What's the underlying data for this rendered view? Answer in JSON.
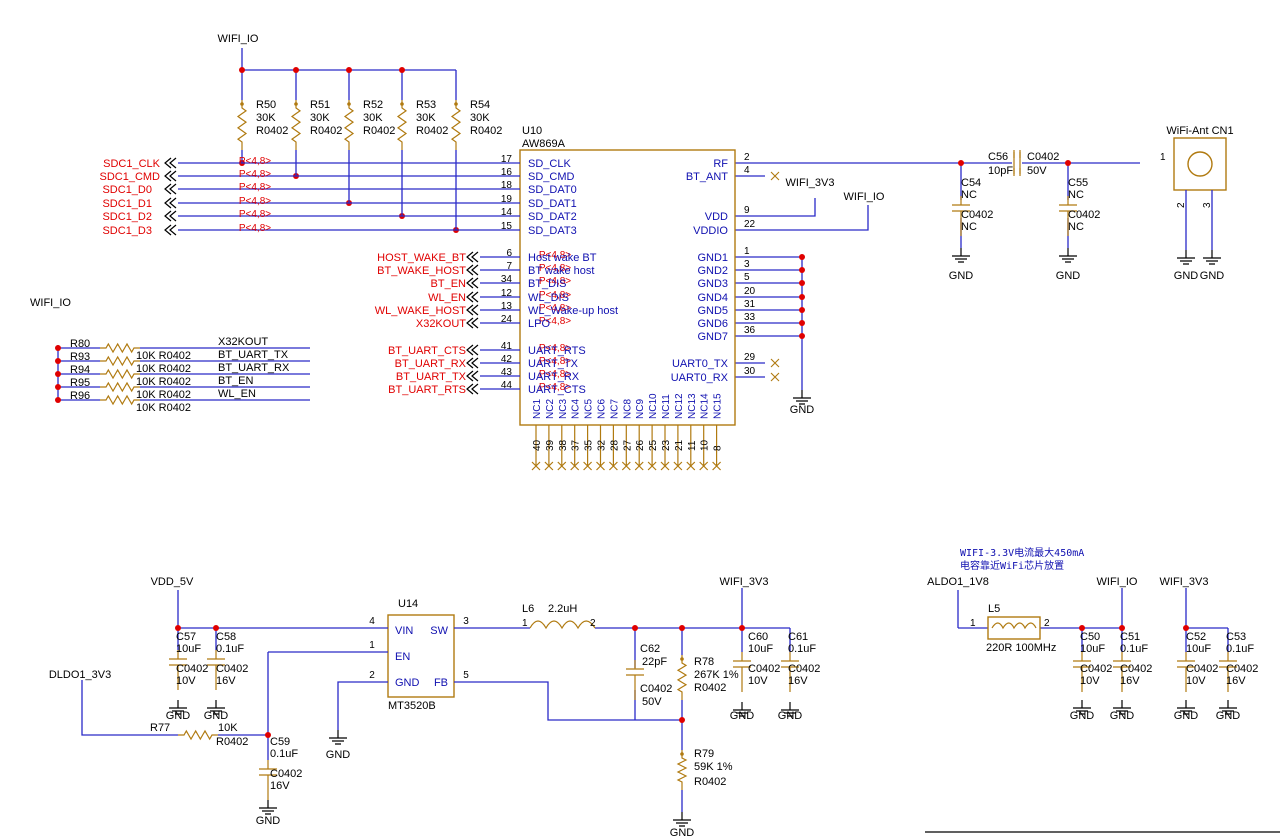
{
  "colors": {
    "wire": "#2a2ac8",
    "net_label": "#e00000",
    "pin_name": "#1010b0",
    "part_outline": "#b07a10",
    "junction": "#e00000"
  },
  "power": {
    "wifi_io": "WIFI_IO",
    "wifi_3v3": "WIFI_3V3",
    "vdd_5v": "VDD_5V",
    "dldo1": "DLDO1_3V3",
    "aldo1": "ALDO1_1V8",
    "gnd": "GND"
  },
  "pullups": [
    {
      "ref": "R50",
      "val": "30K",
      "pkg": "R0402"
    },
    {
      "ref": "R51",
      "val": "30K",
      "pkg": "R0402"
    },
    {
      "ref": "R52",
      "val": "30K",
      "pkg": "R0402"
    },
    {
      "ref": "R53",
      "val": "30K",
      "pkg": "R0402"
    },
    {
      "ref": "R54",
      "val": "30K",
      "pkg": "R0402"
    }
  ],
  "u10": {
    "ref": "U10",
    "part": "AW869A",
    "left_pins": [
      {
        "num": "17",
        "name": "SD_CLK",
        "net": "SDC1_CLK",
        "port": "P<4,8>"
      },
      {
        "num": "16",
        "name": "SD_CMD",
        "net": "SDC1_CMD",
        "port": "P<4,8>"
      },
      {
        "num": "18",
        "name": "SD_DAT0",
        "net": "SDC1_D0",
        "port": "P<4,8>"
      },
      {
        "num": "19",
        "name": "SD_DAT1",
        "net": "SDC1_D1",
        "port": "P<4,8>"
      },
      {
        "num": "14",
        "name": "SD_DAT2",
        "net": "SDC1_D2",
        "port": "P<4,8>"
      },
      {
        "num": "15",
        "name": "SD_DAT3",
        "net": "SDC1_D3",
        "port": "P<4,8>"
      },
      {
        "num": "6",
        "name": "Host wake BT",
        "net": "HOST_WAKE_BT",
        "port": "P<4,8>"
      },
      {
        "num": "7",
        "name": "BT wake host",
        "net": "BT_WAKE_HOST",
        "port": "P<4,8>"
      },
      {
        "num": "34",
        "name": "BT_DIS",
        "net": "BT_EN",
        "port": "P<4,8>"
      },
      {
        "num": "12",
        "name": "WL_DIS",
        "net": "WL_EN",
        "port": "P<4,8>"
      },
      {
        "num": "13",
        "name": "WL_Wake-up host",
        "net": "WL_WAKE_HOST",
        "port": "P<4,8>"
      },
      {
        "num": "24",
        "name": "LPO",
        "net": "X32KOUT",
        "port": "P<4,8>"
      },
      {
        "num": "41",
        "name": "UART_RTS",
        "net": "BT_UART_CTS",
        "port": "P<4,8>"
      },
      {
        "num": "42",
        "name": "UART_TX",
        "net": "BT_UART_RX",
        "port": "P<4,8>"
      },
      {
        "num": "43",
        "name": "UART_RX",
        "net": "BT_UART_TX",
        "port": "P<4,8>"
      },
      {
        "num": "44",
        "name": "UART_CTS",
        "net": "BT_UART_RTS",
        "port": "P<4,8>"
      }
    ],
    "right_pins": [
      {
        "num": "2",
        "name": "RF"
      },
      {
        "num": "4",
        "name": "BT_ANT"
      },
      {
        "num": "9",
        "name": "VDD"
      },
      {
        "num": "22",
        "name": "VDDIO"
      },
      {
        "num": "1",
        "name": "GND1"
      },
      {
        "num": "3",
        "name": "GND2"
      },
      {
        "num": "5",
        "name": "GND3"
      },
      {
        "num": "20",
        "name": "GND4"
      },
      {
        "num": "31",
        "name": "GND5"
      },
      {
        "num": "33",
        "name": "GND6"
      },
      {
        "num": "36",
        "name": "GND7"
      },
      {
        "num": "29",
        "name": "UART0_TX"
      },
      {
        "num": "30",
        "name": "UART0_RX"
      }
    ],
    "bottom_pins": [
      {
        "num": "40",
        "name": "NC1"
      },
      {
        "num": "39",
        "name": "NC2"
      },
      {
        "num": "38",
        "name": "NC3"
      },
      {
        "num": "37",
        "name": "NC4"
      },
      {
        "num": "35",
        "name": "NC5"
      },
      {
        "num": "32",
        "name": "NC6"
      },
      {
        "num": "28",
        "name": "NC7"
      },
      {
        "num": "27",
        "name": "NC8"
      },
      {
        "num": "26",
        "name": "NC9"
      },
      {
        "num": "25",
        "name": "NC10"
      },
      {
        "num": "23",
        "name": "NC11"
      },
      {
        "num": "21",
        "name": "NC12"
      },
      {
        "num": "11",
        "name": "NC13"
      },
      {
        "num": "10",
        "name": "NC14"
      },
      {
        "num": "8",
        "name": "NC15"
      }
    ]
  },
  "antenna": {
    "ref": "WiFi-Ant CN1",
    "pin1": "1",
    "pin2": "2",
    "pin3": "3"
  },
  "rf_parts": {
    "c56": {
      "ref": "C56",
      "val": "10pF",
      "pkg": "C0402",
      "volt": "50V"
    },
    "c54": {
      "ref": "C54",
      "val": "NC",
      "pkg": "C0402",
      "val2": "NC"
    },
    "c55": {
      "ref": "C55",
      "val": "NC",
      "pkg": "C0402",
      "val2": "NC"
    }
  },
  "series_resistors": [
    {
      "ref": "R80",
      "val": "10K R0402",
      "net": "X32KOUT"
    },
    {
      "ref": "R93",
      "val": "10K R0402",
      "net": "BT_UART_TX"
    },
    {
      "ref": "R94",
      "val": "10K R0402",
      "net": "BT_UART_RX"
    },
    {
      "ref": "R95",
      "val": "10K R0402",
      "net": "BT_EN"
    },
    {
      "ref": "R96",
      "val": "10K R0402",
      "net": "WL_EN"
    }
  ],
  "regulator": {
    "ref": "U14",
    "part": "MT3520B",
    "pins": [
      {
        "num": "4",
        "name": "VIN"
      },
      {
        "num": "3",
        "name": "SW"
      },
      {
        "num": "1",
        "name": "EN"
      },
      {
        "num": "2",
        "name": "GND"
      },
      {
        "num": "5",
        "name": "FB"
      }
    ]
  },
  "psu_parts": {
    "l6": {
      "ref": "L6",
      "val": "2.2uH",
      "pin1": "1",
      "pin2": "2"
    },
    "c57": {
      "ref": "C57",
      "val": "10uF",
      "pkg": "C0402",
      "volt": "10V"
    },
    "c58": {
      "ref": "C58",
      "val": "0.1uF",
      "pkg": "C0402",
      "volt": "16V"
    },
    "c59": {
      "ref": "C59",
      "val": "0.1uF",
      "pkg": "C0402",
      "volt": "16V"
    },
    "r77": {
      "ref": "R77",
      "val": "10K",
      "pkg": "R0402"
    },
    "c62": {
      "ref": "C62",
      "val": "22pF",
      "pkg": "C0402",
      "volt": "50V"
    },
    "r78": {
      "ref": "R78",
      "val": "267K 1%",
      "pkg": "R0402"
    },
    "r79": {
      "ref": "R79",
      "val": "59K 1%",
      "pkg": "R0402"
    },
    "c60": {
      "ref": "C60",
      "val": "10uF",
      "pkg": "C0402",
      "volt": "10V"
    },
    "c61": {
      "ref": "C61",
      "val": "0.1uF",
      "pkg": "C0402",
      "volt": "16V"
    }
  },
  "aldo": {
    "note1": "WIFI-3.3V电流最大450mA",
    "note2": "电容靠近WiFi芯片放置",
    "l5": {
      "ref": "L5",
      "val": "220R 100MHz",
      "pin1": "1",
      "pin2": "2"
    },
    "c50": {
      "ref": "C50",
      "val": "10uF",
      "pkg": "C0402",
      "volt": "10V"
    },
    "c51": {
      "ref": "C51",
      "val": "0.1uF",
      "pkg": "C0402",
      "volt": "16V"
    },
    "c52": {
      "ref": "C52",
      "val": "10uF",
      "pkg": "C0402",
      "volt": "10V"
    },
    "c53": {
      "ref": "C53",
      "val": "0.1uF",
      "pkg": "C0402",
      "volt": "16V"
    }
  }
}
